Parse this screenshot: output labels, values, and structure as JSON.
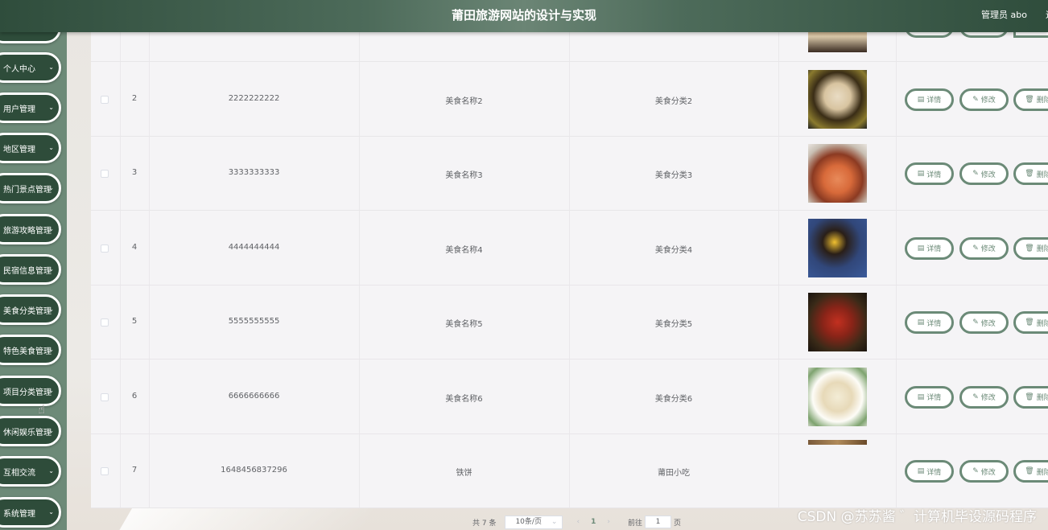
{
  "header": {
    "title": "莆田旅游网站的设计与实现",
    "user": "管理员 abo",
    "logout": "退"
  },
  "sidebar": {
    "items": [
      {
        "label": "个人中心"
      },
      {
        "label": "用户管理"
      },
      {
        "label": "地区管理"
      },
      {
        "label": "热门景点管理"
      },
      {
        "label": "旅游攻略管理"
      },
      {
        "label": "民宿信息管理"
      },
      {
        "label": "美食分类管理"
      },
      {
        "label": "特色美食管理"
      },
      {
        "label": "项目分类管理"
      },
      {
        "label": "休闲娱乐管理"
      },
      {
        "label": "互相交流"
      },
      {
        "label": "系统管理"
      }
    ]
  },
  "table": {
    "rows": [
      {
        "index": "2",
        "code": "2222222222",
        "name": "美食名称2",
        "category": "美食分类2"
      },
      {
        "index": "3",
        "code": "3333333333",
        "name": "美食名称3",
        "category": "美食分类3"
      },
      {
        "index": "4",
        "code": "4444444444",
        "name": "美食名称4",
        "category": "美食分类4"
      },
      {
        "index": "5",
        "code": "5555555555",
        "name": "美食名称5",
        "category": "美食分类5"
      },
      {
        "index": "6",
        "code": "6666666666",
        "name": "美食名称6",
        "category": "美食分类6"
      },
      {
        "index": "7",
        "code": "1648456837296",
        "name": "铁饼",
        "category": "莆田小吃"
      }
    ],
    "actions": {
      "detail": "详情",
      "edit": "修改",
      "delete": "删除"
    }
  },
  "pagination": {
    "total": "共 7 条",
    "page_size": "10条/页",
    "current_page": "1",
    "goto_label": "前往",
    "goto_value": "1",
    "page_unit": "页"
  },
  "watermark": "CSDN @苏苏酱    ゛计算机毕设源码程序",
  "colors": {
    "header": "#3f5e4c",
    "sidebar": "#6d8a78",
    "menu_item": "#2e4c3a",
    "accent": "#6b8a77"
  }
}
